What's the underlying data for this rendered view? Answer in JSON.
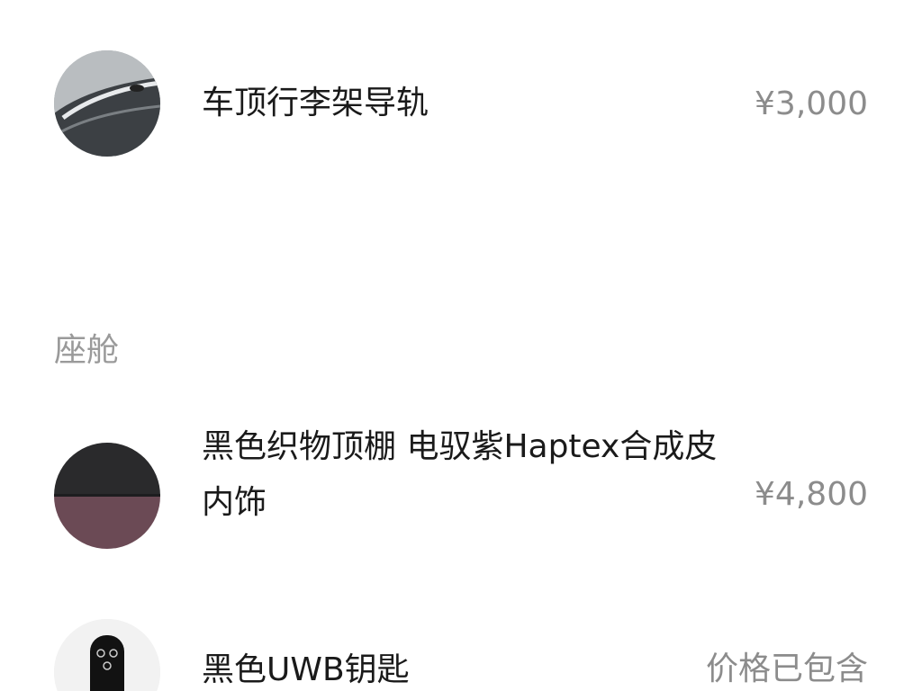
{
  "items_top": {
    "name": "车顶行李架导轨",
    "price": "¥3,000",
    "thumb_icon": "roof-rail-photo"
  },
  "cabin_section": {
    "title": "座舱",
    "items": [
      {
        "name": "黑色织物顶棚 电驭紫Haptex合成皮内饰",
        "price": "¥4,800",
        "thumb_icon": "interior-material-swatch"
      },
      {
        "name": "黑色UWB钥匙",
        "price": "价格已包含",
        "thumb_icon": "car-key-photo"
      }
    ]
  },
  "colors": {
    "text_primary": "#1a1a1a",
    "text_secondary": "#8c8c8c",
    "section_title": "#9a9a9a",
    "swatch_top": "#2a2a2c",
    "swatch_bottom": "#6b4a55"
  }
}
